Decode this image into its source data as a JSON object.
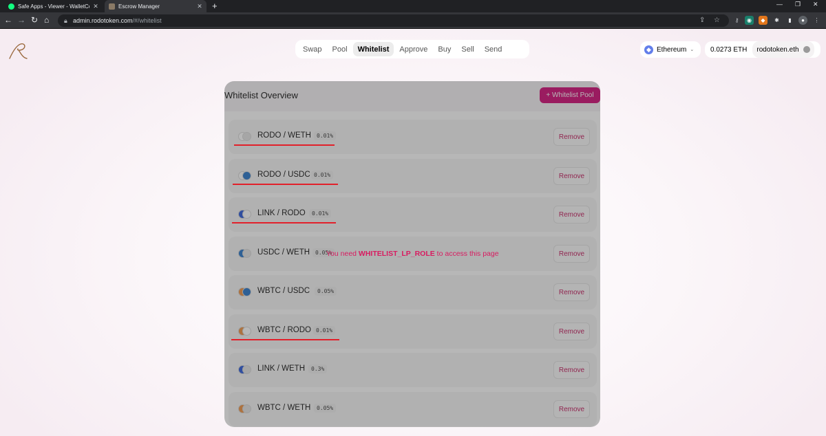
{
  "browser": {
    "tabs": [
      {
        "title": "Safe Apps - Viewer - WalletConn",
        "favicon_color": "#12ff80",
        "active": false
      },
      {
        "title": "Escrow Manager",
        "favicon_color": "#8a7a66",
        "active": true
      }
    ],
    "url_host": "admin.rodotoken.com",
    "url_path": "/#/whitelist"
  },
  "nav": {
    "items": [
      {
        "label": "Swap",
        "active": false
      },
      {
        "label": "Pool",
        "active": false
      },
      {
        "label": "Whitelist",
        "active": true
      },
      {
        "label": "Approve",
        "active": false
      },
      {
        "label": "Buy",
        "active": false
      },
      {
        "label": "Sell",
        "active": false
      },
      {
        "label": "Send",
        "active": false
      }
    ]
  },
  "network": {
    "label": "Ethereum"
  },
  "account": {
    "balance": "0.0273 ETH",
    "name": "rodotoken.eth"
  },
  "panel": {
    "title": "Whitelist Overview",
    "add_button": "+ Whitelist Pool",
    "remove_label": "Remove",
    "access_msg_prefix": "You need ",
    "access_role": "WHITELIST_LP_ROLE",
    "access_msg_suffix": " to access this page",
    "pools": [
      {
        "pair": "RODO / WETH",
        "fee": "0.01%",
        "tokens": [
          "rodo",
          "weth"
        ],
        "marked": true
      },
      {
        "pair": "RODO / USDC",
        "fee": "0.01%",
        "tokens": [
          "rodo",
          "usdc"
        ],
        "marked": true
      },
      {
        "pair": "LINK / RODO",
        "fee": "0.01%",
        "tokens": [
          "link",
          "rodo"
        ],
        "marked": true
      },
      {
        "pair": "USDC / WETH",
        "fee": "0.05%",
        "tokens": [
          "usdc",
          "weth"
        ],
        "marked": false
      },
      {
        "pair": "WBTC / USDC",
        "fee": "0.05%",
        "tokens": [
          "wbtc",
          "usdc"
        ],
        "marked": false
      },
      {
        "pair": "WBTC / RODO",
        "fee": "0.01%",
        "tokens": [
          "wbtc",
          "rodo"
        ],
        "marked": true
      },
      {
        "pair": "LINK / WETH",
        "fee": "0.3%",
        "tokens": [
          "link",
          "weth"
        ],
        "marked": false
      },
      {
        "pair": "WBTC / WETH",
        "fee": "0.05%",
        "tokens": [
          "wbtc",
          "weth"
        ],
        "marked": false
      }
    ]
  },
  "colors": {
    "accent": "#d10a75",
    "remove_text": "#c2185b",
    "annotation_red": "#e2202a",
    "token_link": "#2a5ada",
    "token_usdc": "#2775ca",
    "token_wbtc": "#f09242",
    "token_weth": "#e5e5e5",
    "token_rodo": "#ffffff"
  }
}
